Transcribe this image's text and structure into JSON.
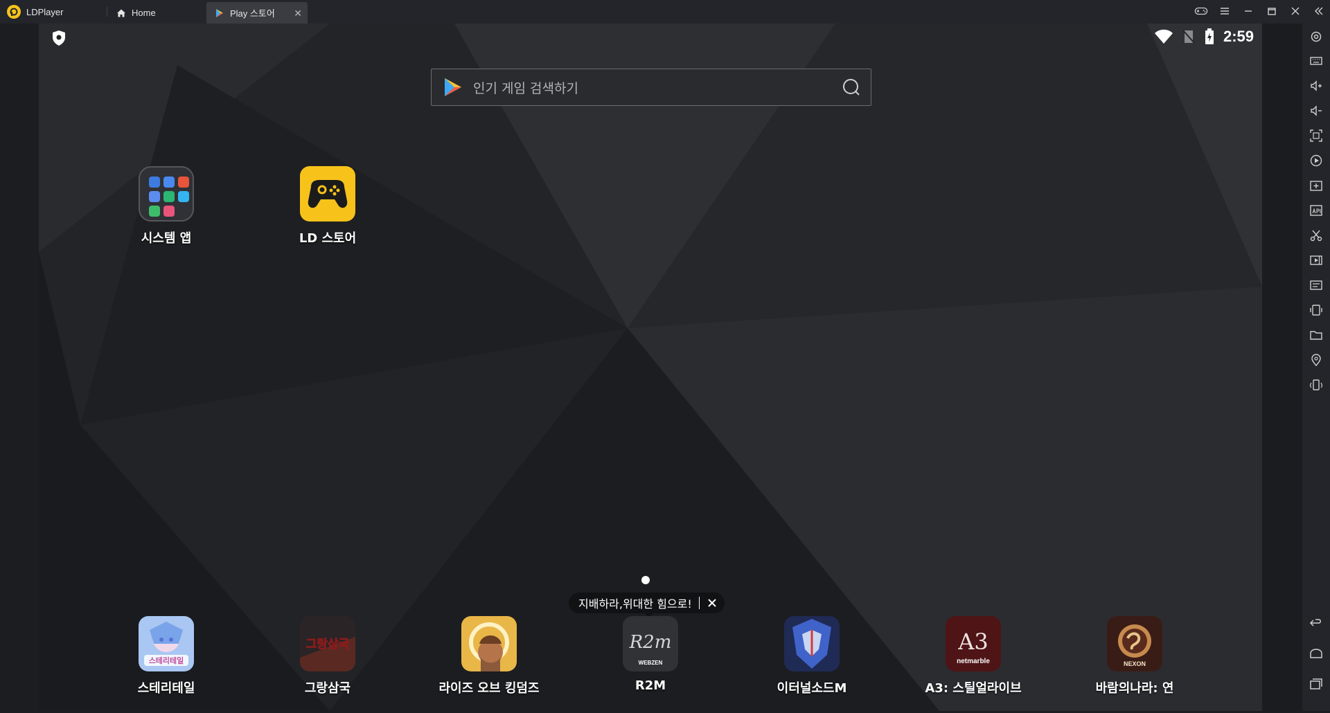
{
  "titlebar": {
    "app_name": "LDPlayer",
    "tabs": [
      {
        "label": "Home",
        "icon": "home-icon"
      },
      {
        "label": "Play 스토어",
        "icon": "play-store-icon"
      }
    ]
  },
  "status_bar": {
    "time": "2:59"
  },
  "search": {
    "placeholder": "인기 게임 검색하기"
  },
  "desktop_apps": [
    {
      "label": "시스템 앱"
    },
    {
      "label": "LD 스토어"
    }
  ],
  "tooltip": {
    "text": "지배하라,위대한 힘으로!"
  },
  "dock_apps": [
    {
      "label": "스테리테일"
    },
    {
      "label": "그랑삼국"
    },
    {
      "label": "라이즈 오브 킹덤즈"
    },
    {
      "label": "R2M"
    },
    {
      "label": "이터널소드M"
    },
    {
      "label": "A3: 스틸얼라이브"
    },
    {
      "label": "바람의나라: 연"
    }
  ],
  "icon_texts": {
    "r2m": "R2m",
    "webzen": "WEBZEN",
    "a3": "A3",
    "netmarble": "netmarble",
    "nexon": "NEXON",
    "stery_logo": "스테리테일",
    "grand_logo": "그랑삼국"
  },
  "colors": {
    "ld_store_yellow": "#f7c31a",
    "titlebar_bg": "#23252a",
    "screen_bg": "#202226"
  }
}
